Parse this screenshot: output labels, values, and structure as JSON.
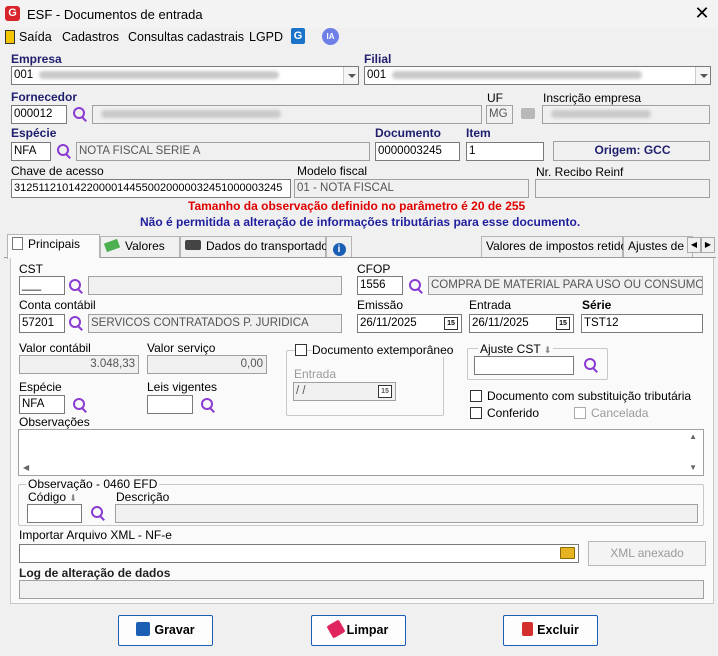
{
  "window": {
    "title": "ESF - Documentos de entrada",
    "close": "✕"
  },
  "menu": [
    {
      "label": "Saída"
    },
    {
      "label": "Cadastros"
    },
    {
      "label": "Consultas cadastrais"
    },
    {
      "label": "LGPD"
    },
    {
      "label": "IA"
    }
  ],
  "header": {
    "empresa_label": "Empresa",
    "empresa_value": "001",
    "filial_label": "Filial",
    "filial_value": "001",
    "fornecedor_label": "Fornecedor",
    "fornecedor_value": "000012",
    "uf_label": "UF",
    "uf_value": "MG",
    "inscricao_label": "Inscrição empresa",
    "especie_label": "Espécie",
    "especie_value": "NFA",
    "especie_desc": "NOTA FISCAL SERIE A",
    "documento_label": "Documento",
    "documento_value": "0000003245",
    "item_label": "Item",
    "item_value": "1",
    "origem": "Origem: GCC",
    "chave_label": "Chave de acesso",
    "chave_value": "31251121014220000144550020000032451000003245",
    "modelo_label": "Modelo fiscal",
    "modelo_value": "01 - NOTA FISCAL",
    "recibo_label": "Nr. Recibo Reinf"
  },
  "messages": {
    "error": "Tamanho da observação definido no parâmetro é 20 de 255",
    "info": "Não é permitida a alteração de informações tributárias para esse documento."
  },
  "tabs": [
    {
      "label": "Principais"
    },
    {
      "label": "Valores"
    },
    {
      "label": "Dados do transportador"
    },
    {
      "label": "Valores de impostos retidos"
    },
    {
      "label": "Ajustes de C"
    }
  ],
  "principais": {
    "cst_label": "CST",
    "cst_value": "___",
    "cfop_label": "CFOP",
    "cfop_value": "1556",
    "cfop_desc": "COMPRA DE MATERIAL PARA USO OU CONSUMO",
    "conta_label": "Conta contábil",
    "conta_value": "57201",
    "conta_desc": "SERVICOS CONTRATADOS P. JURIDICA",
    "emissao_label": "Emissão",
    "emissao_value": "26/11/2025",
    "entrada_label": "Entrada",
    "entrada_value": "26/11/2025",
    "serie_label": "Série",
    "serie_value": "TST12",
    "valor_contabil_label": "Valor contábil",
    "valor_contabil_value": "3.048,33",
    "valor_servico_label": "Valor serviço",
    "valor_servico_value": "0,00",
    "extemporaneo_label": "Documento extemporâneo",
    "extemp_entrada_label": "Entrada",
    "extemp_entrada_value": " /  /",
    "ajuste_cst_label": "Ajuste CST",
    "especie_label": "Espécie",
    "especie_value": "NFA",
    "leis_label": "Leis vigentes",
    "subst_label": "Documento com substituição tributária",
    "conferido_label": "Conferido",
    "cancelada_label": "Cancelada",
    "obs_label": "Observações",
    "obs_efd_label": "Observação - 0460 EFD",
    "codigo_label": "Código",
    "descricao_label": "Descrição",
    "xml_label": "Importar Arquivo XML - NF-e",
    "xml_button": "XML anexado",
    "log_label": "Log de alteração de dados"
  },
  "buttons": {
    "gravar": "Gravar",
    "limpar": "Limpar",
    "excluir": "Excluir"
  },
  "colors": {
    "accent": "#1a5fb4",
    "error": "#e00000",
    "label_blue": "#1f1f6e"
  }
}
